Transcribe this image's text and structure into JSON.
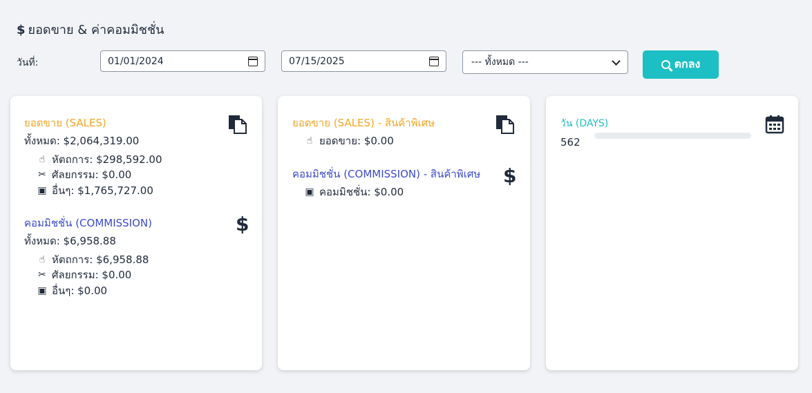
{
  "page": {
    "title_symbol": "$",
    "title": "ยอดขาย & ค่าคอมมิชชั่น"
  },
  "filters": {
    "date_label": "วันที่:",
    "start_date": "01/01/2024",
    "end_date": "07/15/2025",
    "select_value": "--- ทั้งหมด ---",
    "submit_label": "ตกลง"
  },
  "card1": {
    "sales_title": "ยอดขาย (SALES)",
    "sales_total": "ทั้งหมด: $2,064,319.00",
    "sales_items": [
      "หัตถการ: $298,592.00",
      "ศัลยกรรม: $0.00",
      "อื่นๆ: $1,765,727.00"
    ],
    "commission_title": "คอมมิชชั่น (COMMISSION)",
    "commission_total": "ทั้งหมด: $6,958.88",
    "commission_items": [
      "หัตถการ: $6,958.88",
      "ศัลยกรรม: $0.00",
      "อื่นๆ: $0.00"
    ]
  },
  "card2": {
    "sales_title": "ยอดขาย (SALES) - สินค้าพิเศษ",
    "sales_item": "ยอดขาย: $0.00",
    "commission_title": "คอมมิชชั่น (COMMISSION) - สินค้าพิเศษ",
    "commission_item": "คอมมิชชั่น: $0.00"
  },
  "card3": {
    "days_title": "วัน (DAYS)",
    "days_value": "562"
  },
  "icons": {
    "dollar": "$",
    "hand": "☝",
    "scissors": "✂",
    "contact": "▣"
  },
  "colors": {
    "accent": "#1cbfc3",
    "orange": "#f5a623",
    "blue": "#3b4bc8",
    "text": "#1f2a3a"
  }
}
